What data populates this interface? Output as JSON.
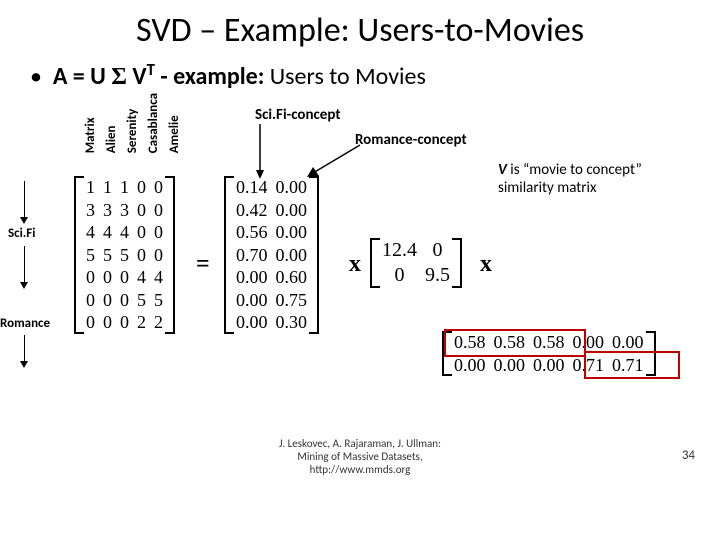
{
  "title": "SVD – Example: Users-to-Movies",
  "subtitle": {
    "prefix": "A = U ",
    "sigma": "Σ",
    "vtsup": "T",
    "vtbase": " V",
    "mid": " - example:",
    "tail": " Users to Movies"
  },
  "columns": [
    "Matrix",
    "Alien",
    "Serenity",
    "Casablanca",
    "Amelie"
  ],
  "groups": {
    "g1": "Sci.Fi",
    "g2": "Romance"
  },
  "A": [
    [
      "1",
      "1",
      "1",
      "0",
      "0"
    ],
    [
      "3",
      "3",
      "3",
      "0",
      "0"
    ],
    [
      "4",
      "4",
      "4",
      "0",
      "0"
    ],
    [
      "5",
      "5",
      "5",
      "0",
      "0"
    ],
    [
      "0",
      "0",
      "0",
      "4",
      "4"
    ],
    [
      "0",
      "0",
      "0",
      "5",
      "5"
    ],
    [
      "0",
      "0",
      "0",
      "2",
      "2"
    ]
  ],
  "eq": "=",
  "xsym": "x",
  "U": [
    [
      "0.14",
      "0.00"
    ],
    [
      "0.42",
      "0.00"
    ],
    [
      "0.56",
      "0.00"
    ],
    [
      "0.70",
      "0.00"
    ],
    [
      "0.00",
      "0.60"
    ],
    [
      "0.00",
      "0.75"
    ],
    [
      "0.00",
      "0.30"
    ]
  ],
  "S": [
    [
      "12.4",
      "0"
    ],
    [
      "0",
      "9.5"
    ]
  ],
  "VT": [
    [
      "0.58",
      "0.58",
      "0.58",
      "0.00",
      "0.00"
    ],
    [
      "0.00",
      "0.00",
      "0.00",
      "0.71",
      "0.71"
    ]
  ],
  "concepts": {
    "c1": "Sci.Fi-concept",
    "c2": "Romance-concept"
  },
  "note": {
    "v": "V",
    "rest": " is “movie to concept” similarity matrix"
  },
  "footer1": "J. Leskovec, A. Rajaraman, J. Ullman:",
  "footer2": "Mining of Massive Datasets,",
  "footer3": "http://www.mmds.org",
  "pagenum": "34",
  "chart_data": {
    "type": "table",
    "title": "SVD of Users-to-Movies matrix A = U Σ Vᵀ",
    "A": {
      "row_groups": [
        "Sci.Fi",
        "Sci.Fi",
        "Sci.Fi",
        "Sci.Fi",
        "Romance",
        "Romance",
        "Romance"
      ],
      "columns": [
        "Matrix",
        "Alien",
        "Serenity",
        "Casablanca",
        "Amelie"
      ],
      "values": [
        [
          1,
          1,
          1,
          0,
          0
        ],
        [
          3,
          3,
          3,
          0,
          0
        ],
        [
          4,
          4,
          4,
          0,
          0
        ],
        [
          5,
          5,
          5,
          0,
          0
        ],
        [
          0,
          0,
          0,
          4,
          4
        ],
        [
          0,
          0,
          0,
          5,
          5
        ],
        [
          0,
          0,
          0,
          2,
          2
        ]
      ]
    },
    "U": {
      "columns": [
        "Sci.Fi-concept",
        "Romance-concept"
      ],
      "values": [
        [
          0.14,
          0.0
        ],
        [
          0.42,
          0.0
        ],
        [
          0.56,
          0.0
        ],
        [
          0.7,
          0.0
        ],
        [
          0.0,
          0.6
        ],
        [
          0.0,
          0.75
        ],
        [
          0.0,
          0.3
        ]
      ]
    },
    "Sigma": [
      [
        12.4,
        0
      ],
      [
        0,
        9.5
      ]
    ],
    "VT": {
      "columns": [
        "Matrix",
        "Alien",
        "Serenity",
        "Casablanca",
        "Amelie"
      ],
      "values": [
        [
          0.58,
          0.58,
          0.58,
          0.0,
          0.0
        ],
        [
          0.0,
          0.0,
          0.0,
          0.71,
          0.71
        ]
      ],
      "note": "V is “movie to concept” similarity matrix",
      "highlight_rows": {
        "0": [
          0,
          1,
          2
        ],
        "1": [
          3,
          4
        ]
      }
    }
  }
}
